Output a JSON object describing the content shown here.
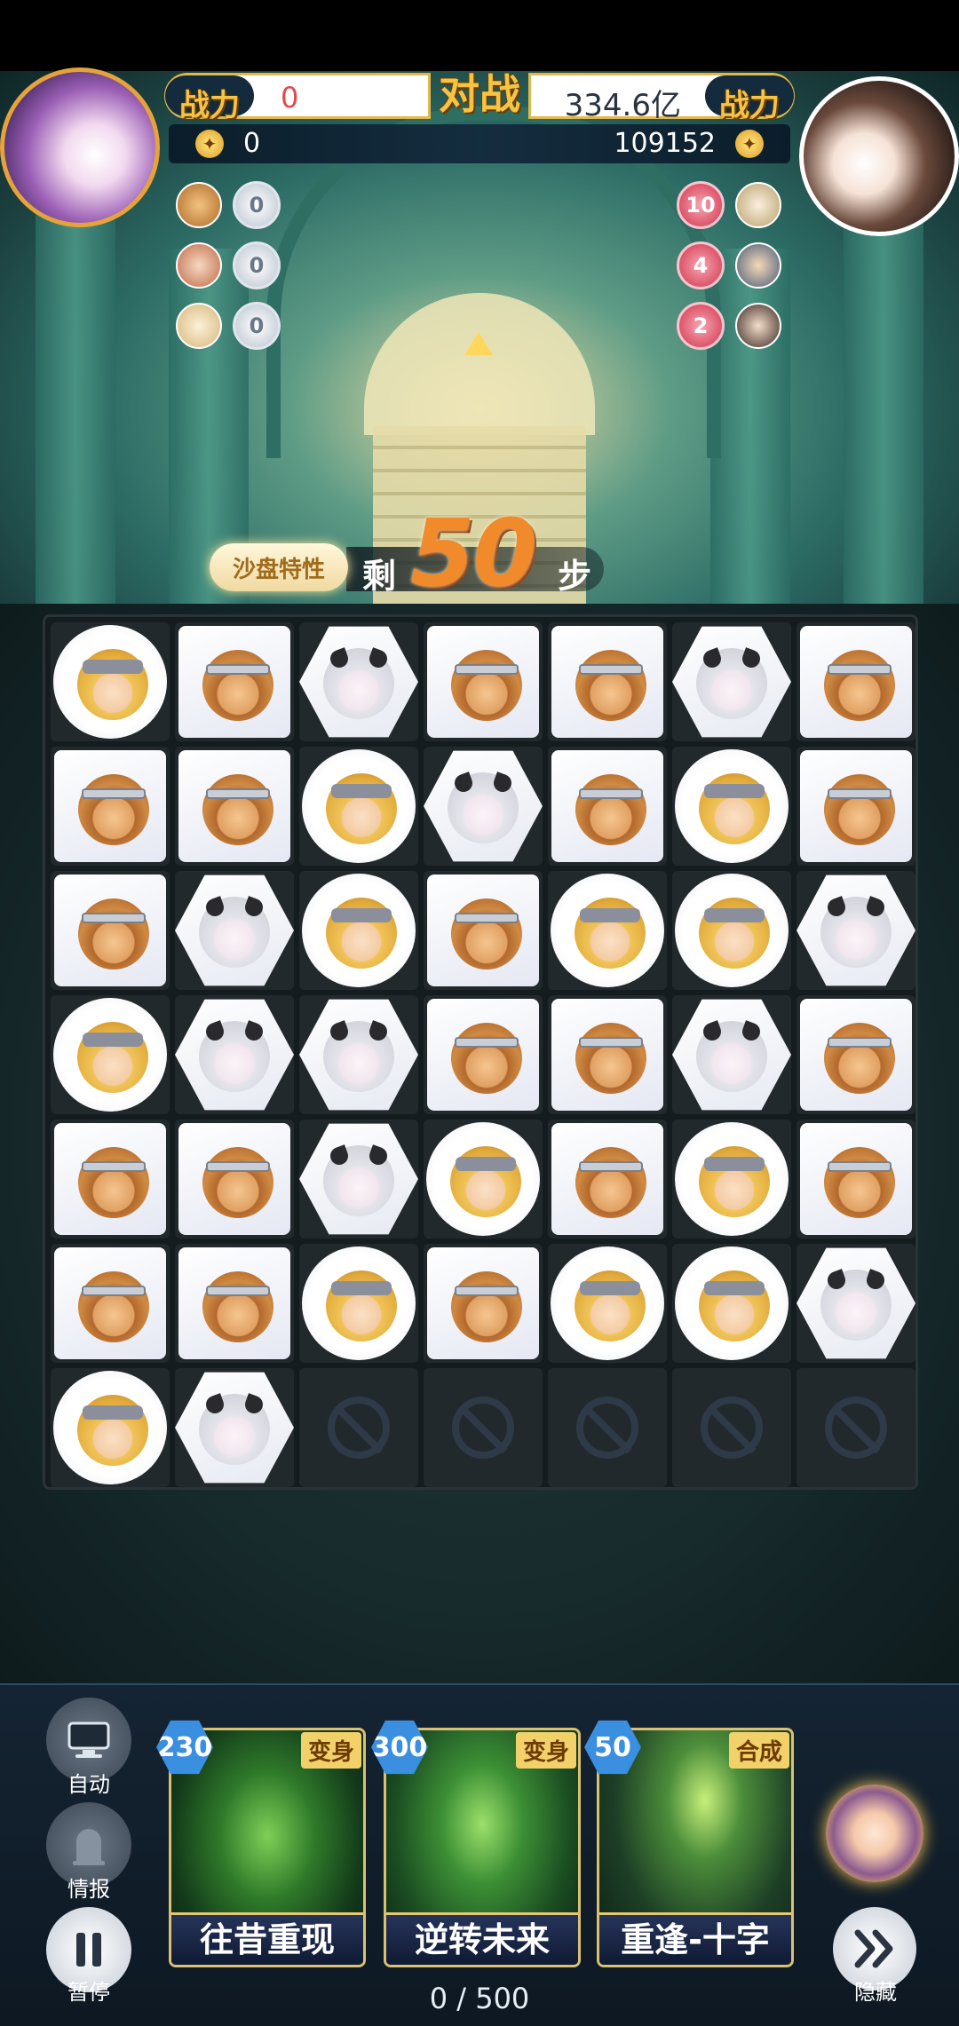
{
  "header": {
    "left_power_label": "战力",
    "left_power_value": "0",
    "vs_label": "对战",
    "right_power_value": "334.6亿",
    "right_power_label": "战力",
    "left_score": "0",
    "right_score": "109152"
  },
  "left_team_counts": [
    "0",
    "0",
    "0"
  ],
  "right_team_counts": [
    "10",
    "4",
    "2"
  ],
  "sandtable_label": "沙盘特性",
  "steps": {
    "prefix": "剩",
    "value": "50",
    "suffix": "步"
  },
  "board": {
    "rows": 7,
    "cols": 7,
    "tiles": [
      [
        "blond",
        "monkey",
        "white",
        "monkey",
        "monkey",
        "white",
        "monkey"
      ],
      [
        "monkey",
        "monkey",
        "blond",
        "white",
        "monkey",
        "blond",
        "monkey"
      ],
      [
        "monkey",
        "white",
        "blond",
        "monkey",
        "blond",
        "blond",
        "white"
      ],
      [
        "blond",
        "white",
        "white",
        "monkey",
        "monkey",
        "white",
        "monkey"
      ],
      [
        "monkey",
        "monkey",
        "white",
        "blond",
        "monkey",
        "blond",
        "monkey"
      ],
      [
        "monkey",
        "monkey",
        "blond",
        "monkey",
        "blond",
        "blond",
        "white"
      ],
      [
        "blond",
        "white",
        "blocked",
        "blocked",
        "blocked",
        "blocked",
        "blocked"
      ]
    ]
  },
  "controls": {
    "auto_label": "自动",
    "intel_label": "情报",
    "pause_label": "暂停",
    "hide_label": "隐藏"
  },
  "cards": [
    {
      "cost": "230",
      "tag": "变身",
      "name": "往昔重现"
    },
    {
      "cost": "300",
      "tag": "变身",
      "name": "逆转未来"
    },
    {
      "cost": "50",
      "tag": "合成",
      "name": "重逢-十字"
    }
  ],
  "energy": "0 / 500"
}
